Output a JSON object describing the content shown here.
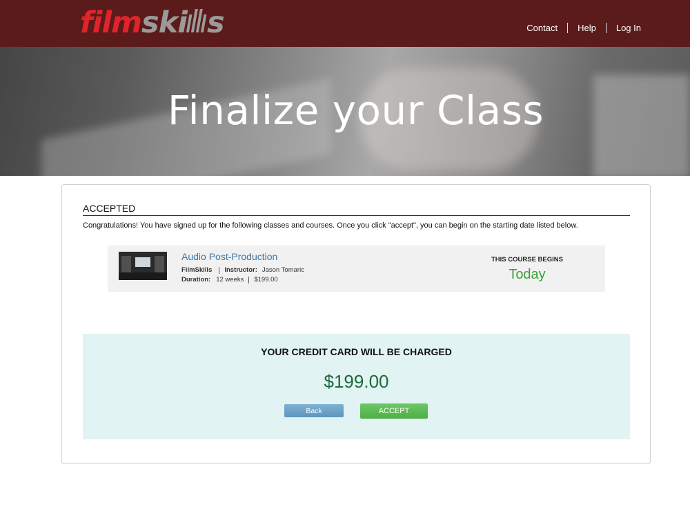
{
  "header": {
    "logo": {
      "part1": "film",
      "part2": "skills"
    },
    "nav": {
      "contact": "Contact",
      "help": "Help",
      "login": "Log In"
    }
  },
  "hero": {
    "title": "Finalize your Class"
  },
  "accepted": {
    "heading": "ACCEPTED",
    "message": "Congratulations! You have signed up for the following classes and courses. Once you click \"accept\", you can begin on the starting date listed below."
  },
  "course": {
    "name": "Audio Post-Production",
    "provider": "FilmSkills",
    "instructor_label": "Instructor:",
    "instructor": "Jason Tomaric",
    "duration_label": "Duration:",
    "duration": "12 weeks",
    "price": "$199.00",
    "begins_label": "THIS COURSE BEGINS",
    "begins_value": "Today"
  },
  "charge": {
    "title": "YOUR CREDIT CARD WILL BE CHARGED",
    "amount": "$199.00",
    "back_label": "Back",
    "accept_label": "ACCEPT"
  },
  "colors": {
    "header_bg": "#5c1b1b",
    "logo_red": "#e0242a",
    "logo_gray": "#9a9a9a",
    "course_link": "#3b77a6",
    "today_green": "#3aa135",
    "charge_bg": "#e1f3f2",
    "amount_green": "#1f6a3c",
    "back_button": "#6aa3c9",
    "accept_button": "#5cba52"
  }
}
